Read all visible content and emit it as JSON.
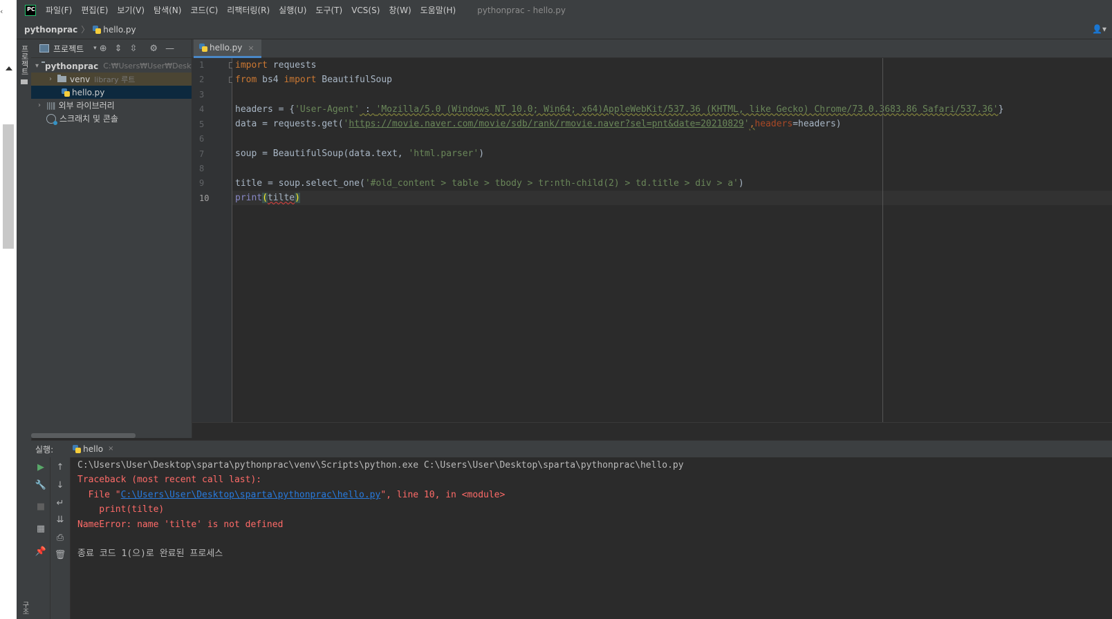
{
  "menu": {
    "app_icon": "PC",
    "items": [
      "파일(F)",
      "편집(E)",
      "보기(V)",
      "탐색(N)",
      "코드(C)",
      "리팩터링(R)",
      "실행(U)",
      "도구(T)",
      "VCS(S)",
      "창(W)",
      "도움말(H)"
    ],
    "window_title": "pythonprac - hello.py"
  },
  "navbar": {
    "root": "pythonprac",
    "separator": "〉",
    "file": "hello.py"
  },
  "sidestripe": {
    "project_label": "프로젝트",
    "bottom_label": "구조"
  },
  "project_panel": {
    "title": "프로젝트",
    "tree": [
      {
        "name": "pythonprac",
        "path": "C:₩Users₩User₩Deskto"
      },
      {
        "name": "venv",
        "note": "library 루트"
      },
      {
        "name": "hello.py"
      },
      {
        "name": "외부 라이브러리"
      },
      {
        "name": "스크래치 및 콘솔"
      }
    ]
  },
  "editor": {
    "tab_label": "hello.py",
    "tab_close": "×",
    "line_numbers": [
      "1",
      "2",
      "3",
      "4",
      "5",
      "6",
      "7",
      "8",
      "9",
      "10"
    ],
    "lines": {
      "l1_kw": "import",
      "l1_rest": " requests",
      "l2_kw1": "from",
      "l2_mid": " bs4 ",
      "l2_kw2": "import",
      "l2_rest": " BeautifulSoup",
      "l4_a": "headers = {",
      "l4_key": "'User-Agent'",
      "l4_sep": " : ",
      "l4_val": "'Mozilla/5.0 (Windows NT 10.0; Win64; x64)AppleWebKit/537.36 (KHTML, like Gecko) Chrome/73.0.3683.86 Safari/537.36'",
      "l4_end": "}",
      "l5_a": "data = requests.get(",
      "l5_q1": "'",
      "l5_url": "https://movie.naver.com/movie/sdb/rank/rmovie.naver?sel=pnt&date=20210829",
      "l5_q2": "'",
      "l5_comma": ",",
      "l5_param": "headers",
      "l5_rest": "=headers)",
      "l7_a": "soup = BeautifulSoup(data.text, ",
      "l7_str": "'html.parser'",
      "l7_end": ")",
      "l9_a": "title = soup.select_one(",
      "l9_str": "'#old_content > table > tbody > tr:nth-child(2) > td.title > div > a'",
      "l9_end": ")",
      "l10_fn": "print",
      "l10_open": "(",
      "l10_arg": "tilte",
      "l10_close": ")"
    }
  },
  "run_panel": {
    "label": "실행:",
    "tab_label": "hello",
    "tab_close": "×",
    "console": {
      "cmd": "C:\\Users\\User\\Desktop\\sparta\\pythonprac\\venv\\Scripts\\python.exe C:\\Users\\User\\Desktop\\sparta\\pythonprac\\hello.py",
      "traceback": "Traceback (most recent call last):",
      "file_prefix": "  File \"",
      "file_link": "C:\\Users\\User\\Desktop\\sparta\\pythonprac\\hello.py",
      "file_suffix": "\", line 10, in <module>",
      "code_line": "    print(tilte)",
      "error": "NameError: name 'tilte' is not defined",
      "exit": "종료 코드 1(으)로 완료된 프로세스"
    }
  },
  "colors": {
    "keyword": "#cc7832",
    "string": "#6a8759",
    "error_text": "#ff6b68",
    "link": "#287bde",
    "run_green": "#59a869"
  }
}
